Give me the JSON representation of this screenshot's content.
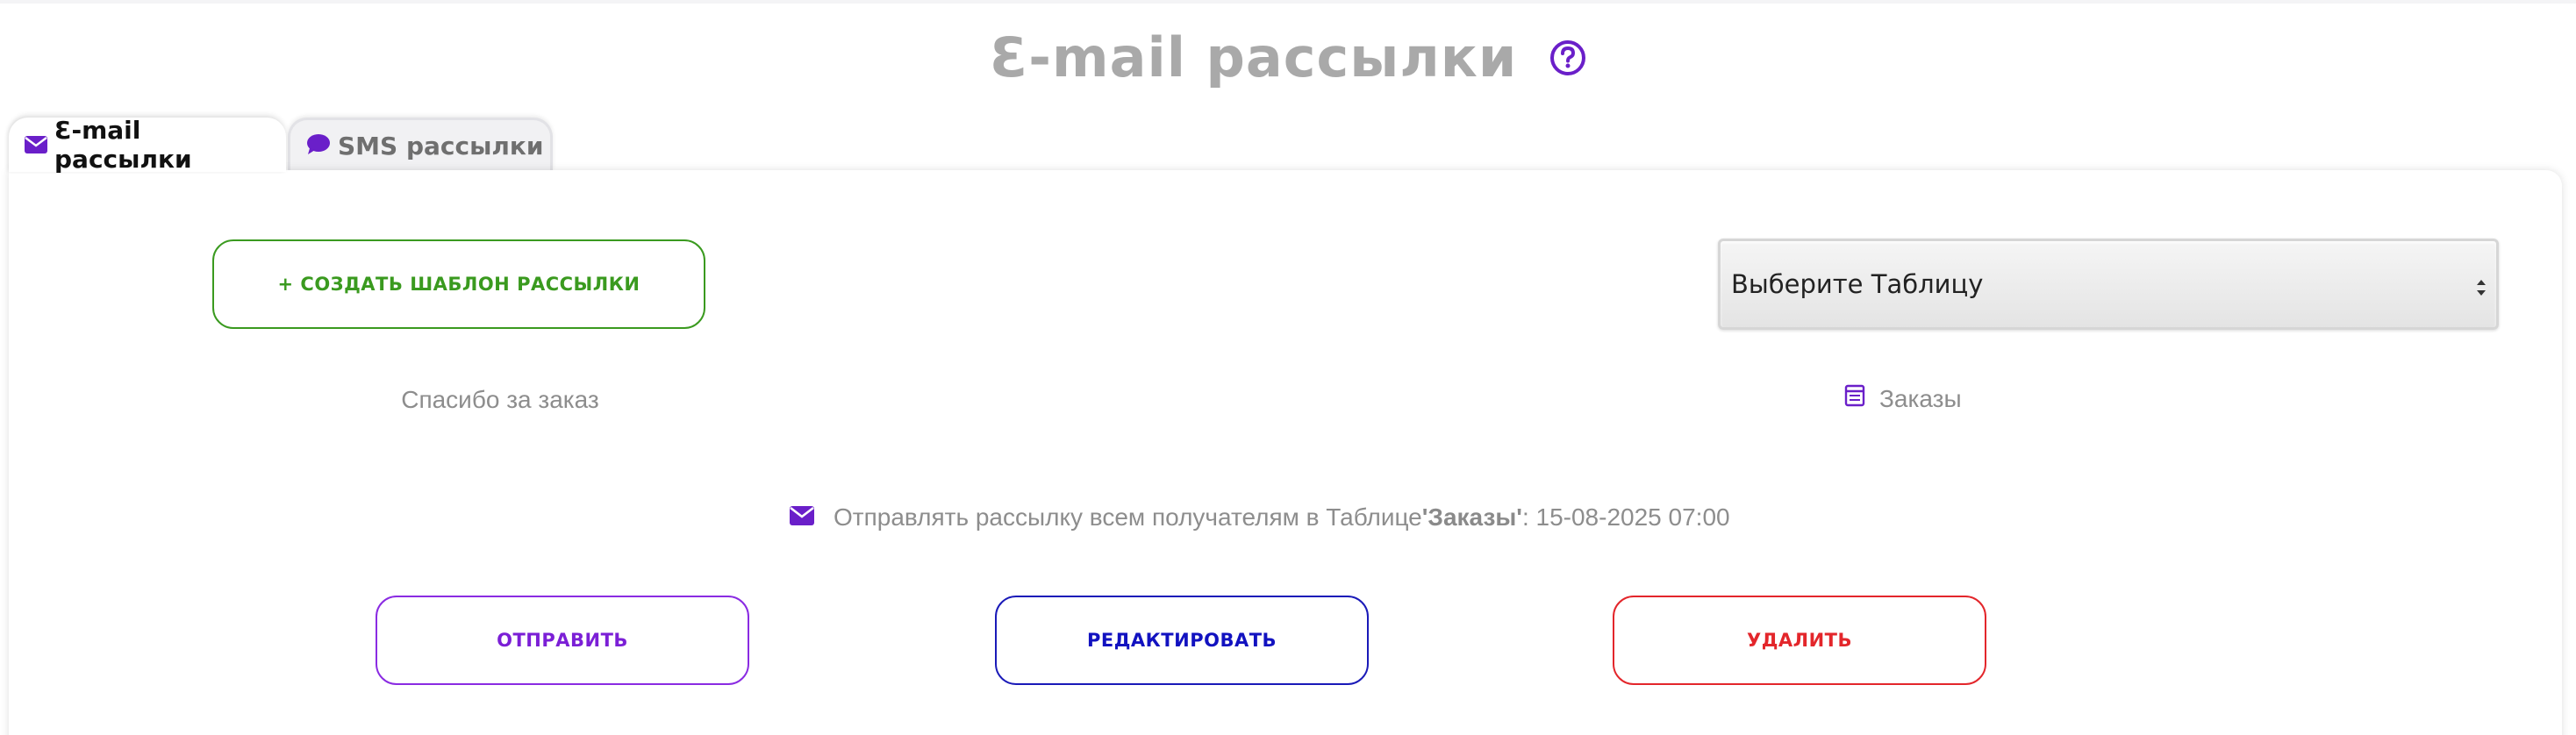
{
  "page": {
    "title": "Ɛ-mail рассылки"
  },
  "tabs": [
    {
      "label": "Ɛ-mail рассылки",
      "icon": "envelope-icon",
      "active": true
    },
    {
      "label": "SMS рассылки",
      "icon": "chat-bubble-icon",
      "active": false
    }
  ],
  "toolbar": {
    "create_label": "+ Создать шаблон рассылки",
    "table_select_value": "Выберите Таблицу"
  },
  "template": {
    "name": "Спасибо за заказ",
    "table_name": "Заказы",
    "schedule_prefix": "Отправлять рассылку всем получателям в Таблице ",
    "schedule_table": "'Заказы'",
    "schedule_suffix": ": 15-08-2025 07:00"
  },
  "actions": {
    "send_label": "Отправить",
    "edit_label": "Редактировать",
    "delete_label": "Удалить"
  },
  "colors": {
    "accent": "#6a1fc9",
    "create": "#3a9a1f",
    "send": "#7b1fd6",
    "edit": "#1212c0",
    "delete": "#e3262b",
    "muted_text": "#8d8d8d",
    "title": "#a9a9a9"
  }
}
